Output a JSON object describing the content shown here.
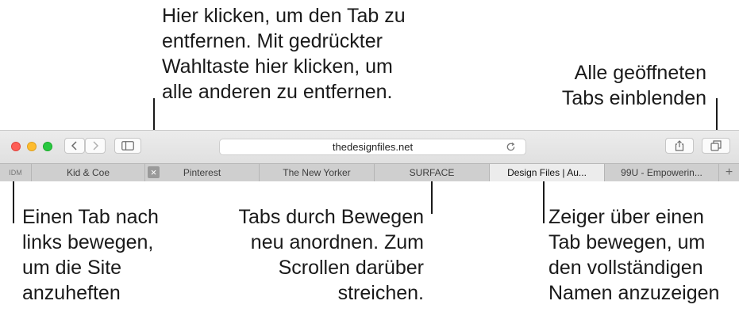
{
  "callouts": {
    "close_tab": [
      "Hier klicken, um den Tab zu",
      "entfernen. Mit gedrückter",
      "Wahltaste hier klicken, um",
      "alle anderen zu entfernen."
    ],
    "show_all_tabs": [
      "Alle geöffneten",
      "Tabs einblenden"
    ],
    "pin_tab": [
      "Einen Tab nach",
      "links bewegen,",
      "um die Site",
      "anzuheften"
    ],
    "rearrange": [
      "Tabs durch Bewegen",
      "neu anordnen. Zum",
      "Scrollen darüber",
      "streichen."
    ],
    "hover_name": [
      "Zeiger über einen",
      "Tab bewegen, um",
      "den vollständigen",
      "Namen anzuzeigen"
    ]
  },
  "browser": {
    "address": "thedesignfiles.net",
    "colors": {
      "close": "#fe5f57",
      "minimize": "#febc2e",
      "zoom": "#28c840"
    },
    "tabs": {
      "pinned": "IDM",
      "items": [
        "Kid & Coe",
        "Pinterest",
        "The New Yorker",
        "SURFACE",
        "Design Files | Au...",
        "99U - Empowerin..."
      ],
      "active_index": 4,
      "add": "+"
    },
    "icons": [
      "chevron-left-icon",
      "chevron-right-icon",
      "sidebar-icon",
      "reload-icon",
      "share-icon",
      "tab-overview-icon",
      "close-tab-icon"
    ]
  }
}
